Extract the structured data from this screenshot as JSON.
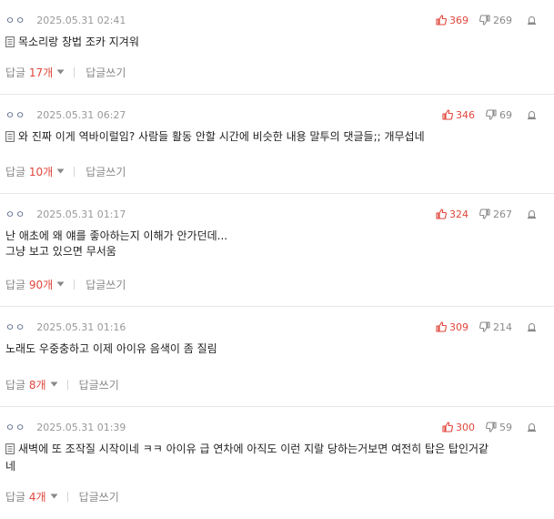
{
  "comments": [
    {
      "nickname": "ㅇㅇ",
      "date": "2025.05.31 02:41",
      "upvotes": "369",
      "downvotes": "269",
      "has_doc_icon": true,
      "lines": [
        "목소리랑 창법 조카 지겨워"
      ],
      "reply_prefix": "답글 ",
      "reply_count": "17개",
      "write_reply": "답글쓰기"
    },
    {
      "nickname": "ㅇㅇ",
      "date": "2025.05.31 06:27",
      "upvotes": "346",
      "downvotes": "69",
      "has_doc_icon": true,
      "lines": [
        "와 진짜 이게 역바이럴임? 사람들 활동 안할 시간에 비슷한 내용 말투의 댓글들;; 개무섭네"
      ],
      "reply_prefix": "답글 ",
      "reply_count": "10개",
      "write_reply": "답글쓰기"
    },
    {
      "nickname": "ㅇㅇ",
      "date": "2025.05.31 01:17",
      "upvotes": "324",
      "downvotes": "267",
      "has_doc_icon": false,
      "lines": [
        "난 애초에 왜 얘를 좋아하는지 이해가 안가던데...",
        "그냥 보고 있으면 무서움"
      ],
      "reply_prefix": "답글 ",
      "reply_count": "90개",
      "write_reply": "답글쓰기"
    },
    {
      "nickname": "ㅇㅇ",
      "date": "2025.05.31 01:16",
      "upvotes": "309",
      "downvotes": "214",
      "has_doc_icon": false,
      "lines": [
        "노래도 우중충하고 이제 아이유 음색이 좀 질림"
      ],
      "reply_prefix": "답글 ",
      "reply_count": "8개",
      "write_reply": "답글쓰기"
    },
    {
      "nickname": "ㅇㅇ",
      "date": "2025.05.31 01:39",
      "upvotes": "300",
      "downvotes": "59",
      "has_doc_icon": true,
      "lines": [
        "새벽에 또 조작질 시작이네 ㅋㅋ 아이유 급 연차에 아직도 이런 지랄 당하는거보면 여전히 탑은 탑인거같",
        "네"
      ],
      "reply_prefix": "답글 ",
      "reply_count": "4개",
      "write_reply": "답글쓰기"
    }
  ],
  "icons": {
    "upvote": "thumbs-up-icon",
    "downvote": "thumbs-down-icon",
    "report": "report-siren-icon",
    "document": "document-icon",
    "expand": "caret-down-icon"
  },
  "colors": {
    "upvote": "#e0463c",
    "reply_count": "#e0463c",
    "muted": "#888888",
    "nickname": "#5b6b8c",
    "divider": "#e6e6e6"
  }
}
